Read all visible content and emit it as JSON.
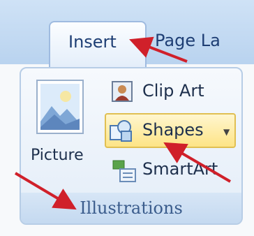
{
  "tabs": {
    "insert_label": "Insert",
    "page_layout_label": "Page La"
  },
  "group": {
    "label": "Illustrations",
    "picture_label": "Picture",
    "clip_art_label": "Clip Art",
    "shapes_label": "Shapes",
    "smartart_label": "SmartArt"
  },
  "icons": {
    "picture": "picture-icon",
    "clip_art": "clip-art-icon",
    "shapes": "shapes-icon",
    "smartart": "smartart-icon",
    "dropdown": "chevron-down-icon"
  },
  "colors": {
    "annotation_arrow": "#d0202a",
    "shapes_highlight": "#fde486",
    "tab_strip": "#c4dbf2"
  }
}
